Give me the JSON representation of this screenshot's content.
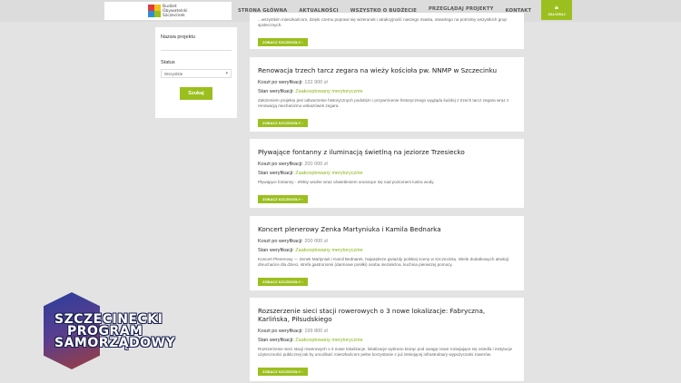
{
  "header": {
    "logo_lines": [
      "Budżet",
      "Obywatelski",
      "Szczecinek"
    ],
    "nav": [
      {
        "label": "STRONA GŁÓWNA",
        "active": false
      },
      {
        "label": "AKTUALNOŚCI",
        "active": false
      },
      {
        "label": "WSZYSTKO O BUDŻECIE",
        "active": false
      },
      {
        "label": "PRZEGLĄDAJ PROJEKTY",
        "active": true
      },
      {
        "label": "KONTAKT",
        "active": false
      }
    ],
    "login_label": "ZALOGUJ",
    "accent": "#9bbf1e"
  },
  "filter": {
    "name_label": "Nazwa projektu",
    "status_label": "Status",
    "status_value": "Wszystkie",
    "search_label": "Szukaj"
  },
  "top_card": {
    "desc": "...wszystkim mieszkańcom, dzięki czemu poprawi się wizerunek i atrakcyjność naszego miasta, otwartego na potrzeby wszystkich grup społecznych.",
    "button": "ZOBACZ SZCZEGÓŁY"
  },
  "projects": [
    {
      "title": "Renowacja trzech tarcz zegara na wieży kościoła pw. NNMP w Szczecinku",
      "cost_label": "Koszt po weryfikacji:",
      "cost": "132 900 zł",
      "status_label": "Stan weryfikacji:",
      "status": "Zaakceptowany merytorycznie",
      "desc": "Założeniem projektu jest odtworzenie historycznych podobizn i przywrócenie historycznego wyglądu każdej z trzech tarcz zegara wraz z renowacją mechanizmu wskazówek zegara.",
      "button": "ZOBACZ SZCZEGÓŁY"
    },
    {
      "title": "Pływające fontanny z iluminacją świetlną na jeziorze Trzesiecko",
      "cost_label": "Koszt po weryfikacji:",
      "cost": "200 000 zł",
      "status_label": "Stan weryfikacji:",
      "status": "Zaakceptowany merytorycznie",
      "desc": "Pływające fontanny - efekty wodne wraz oświetleniem unoszące się nad poziomem lustra wody.",
      "button": "ZOBACZ SZCZEGÓŁY"
    },
    {
      "title": "Koncert plenerowy Zenka Martyniuka i Kamila Bednarka",
      "cost_label": "Koszt po weryfikacji:",
      "cost": "200 000 zł",
      "status_label": "Stan weryfikacji:",
      "status": "Zaakceptowany merytorycznie",
      "desc": "Koncert Plenerowy — Zenek Martyniuk i Kamil Bednarek. Największe gwiazdy polskiej sceny w Szczecinku. Wiele dodatkowych atrakcji: dmuchańce dla dzieci, strefa gastronomii (darmowe posiłki) osoba niezależna, kuchnia pierwszej pomocy.",
      "button": "ZOBACZ SZCZEGÓŁY"
    },
    {
      "title": "Rozszerzenie sieci stacji rowerowych o 3 nowe lokalizacje: Fabryczna, Karlińska, Piłsudskiego",
      "cost_label": "Koszt po weryfikacji:",
      "cost": "199 800 zł",
      "status_label": "Stan weryfikacji:",
      "status": "Zaakceptowany merytorycznie",
      "desc": "Rozszerzenie sieci stacji rowerowych o 3 nowe lokalizacje. lokalizacje wybrano biorąc pod uwagę nowe rozwijające się osiedla i instytucje użyteczności publicznej tak by umożliwić mieszkańcom pełne korzystanie z już istniejącej infrastruktury wypożyczalni rowerów.",
      "button": "ZOBACZ SZCZEGÓŁY"
    }
  ],
  "watermark": {
    "lines": [
      "SZCZECINECKI",
      "PROGRAM",
      "SAMORZĄDOWY"
    ]
  }
}
